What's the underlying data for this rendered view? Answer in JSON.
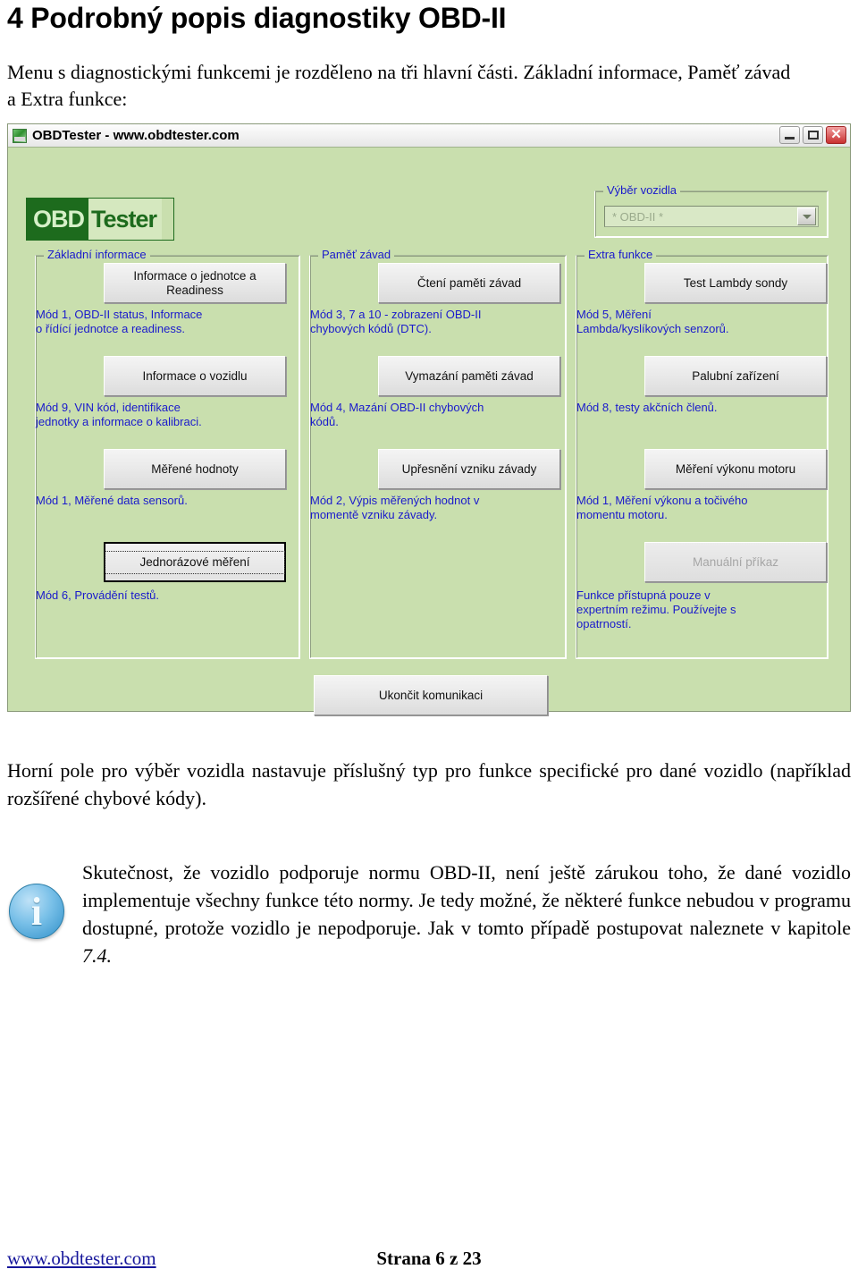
{
  "document": {
    "heading": "4 Podrobný popis diagnostiky OBD-II",
    "intro_line1": "Menu s diagnostickými funkcemi je rozděleno na tři hlavní části. Základní informace, Paměť závad",
    "intro_line2": "a Extra funkce:",
    "paragraph_top": "Horní pole pro výběr vozidla nastavuje příslušný typ pro funkce specifické pro dané vozidlo (například rozšířené chybové kódy).",
    "note": {
      "text": "Skutečnost, že vozidlo podporuje normu OBD-II, není ještě zárukou toho, že dané vozidlo implementuje všechny funkce této normy. Je tedy možné, že některé funkce nebudou v programu dostupné, protože vozidlo je nepodporuje. Jak v tomto případě postupovat naleznete v kapitole ",
      "reference": "7.4."
    }
  },
  "footer": {
    "website": "www.obdtester.com",
    "page": "Strana 6 z 23"
  },
  "app_window": {
    "title": "OBDTester - www.obdtester.com",
    "titlebar_buttons": {
      "minimize": "minimize-icon",
      "maximize": "maximize-icon",
      "close": "✕"
    },
    "logo": {
      "part1": "OBD",
      "part2": "Tester"
    },
    "vehicle_select": {
      "group_label": "Výběr vozidla",
      "selected_value": "* OBD-II *",
      "dropdown_icon": "chevron-down-icon"
    },
    "columns": [
      {
        "id": "basic",
        "group_label": "Základní informace",
        "items": [
          {
            "button": "Informace o jednotce a Readiness",
            "description": "Mód 1, OBD-II status, Informace\no řídící jednotce a readiness.",
            "state": "normal"
          },
          {
            "button": "Informace o vozidlu",
            "description": "Mód 9, VIN kód, identifikace\njednotky a informace o kalibraci.",
            "state": "normal"
          },
          {
            "button": "Měřené hodnoty",
            "description": "Mód 1, Měřené data sensorů.",
            "state": "normal"
          },
          {
            "button": "Jednorázové měření",
            "description": "Mód 6, Provádění testů.",
            "state": "focused"
          }
        ]
      },
      {
        "id": "memory",
        "group_label": "Paměť závad",
        "items": [
          {
            "button": "Čtení paměti závad",
            "description": "Mód 3, 7 a 10 - zobrazení OBD-II\nchybových kódů (DTC).",
            "state": "normal"
          },
          {
            "button": "Vymazání paměti závad",
            "description": "Mód 4, Mazání OBD-II chybových\nkódů.",
            "state": "normal"
          },
          {
            "button": "Upřesnění vzniku závady",
            "description": "Mód 2, Výpis měřených hodnot v\nmomentě vzniku závady.",
            "state": "normal"
          }
        ]
      },
      {
        "id": "extra",
        "group_label": "Extra funkce",
        "items": [
          {
            "button": "Test Lambdy sondy",
            "description": "Mód 5, Měření\nLambda/kyslíkových senzorů.",
            "state": "normal"
          },
          {
            "button": "Palubní zařízení",
            "description": "Mód 8, testy akčních členů.",
            "state": "normal"
          },
          {
            "button": "Měření výkonu motoru",
            "description": "Mód 1, Měření výkonu a točivého\nmomentu motoru.",
            "state": "normal"
          },
          {
            "button": "Manuální příkaz",
            "description": "Funkce přístupná pouze v\nexpertním režimu. Používejte s\nopatrností.",
            "state": "disabled"
          }
        ]
      }
    ],
    "disconnect_button": "Ukončit komunikaci"
  },
  "colors": {
    "window_background": "#c9dfae",
    "description_text": "#1a1acc",
    "logo_green": "#1d6b1d",
    "link": "#16169b"
  }
}
